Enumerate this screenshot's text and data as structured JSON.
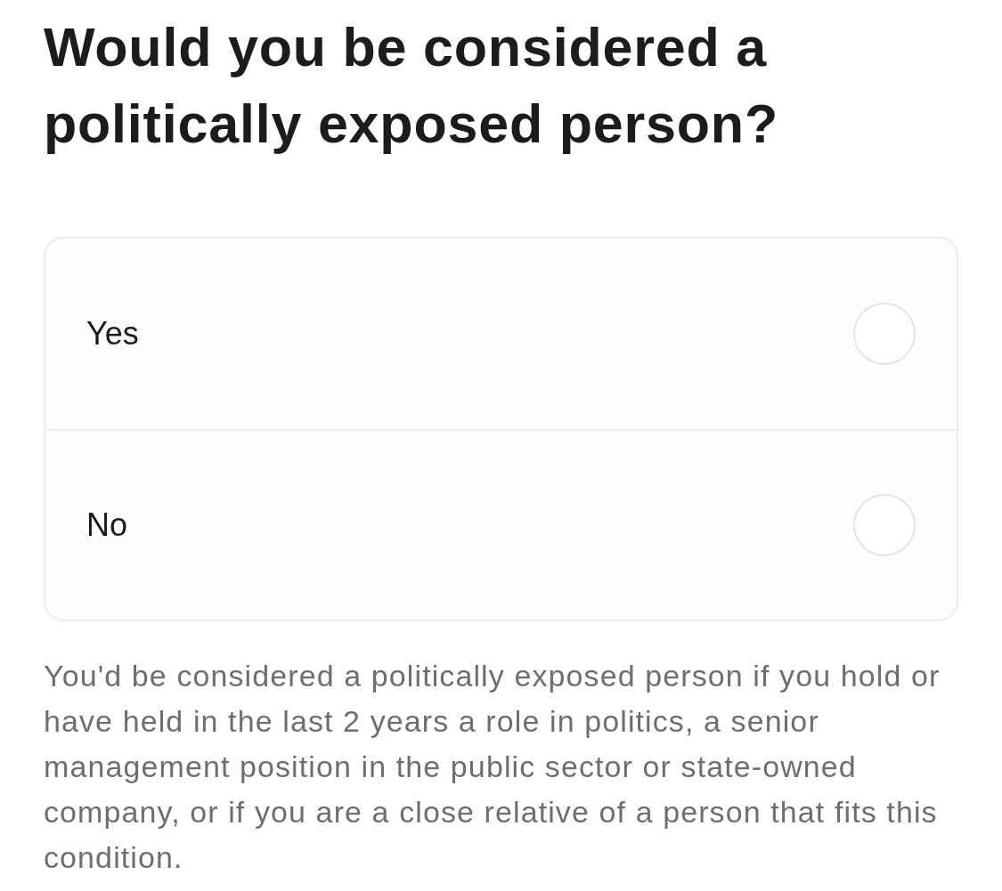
{
  "question": {
    "title": "Would you be considered a politically exposed person?"
  },
  "options": [
    {
      "label": "Yes",
      "selected": false
    },
    {
      "label": "No",
      "selected": false
    }
  ],
  "explanation": "You'd be considered a politically exposed person if you hold or have held in the last 2 years a role in politics, a senior management position in the public sector or state-owned company, or if you are a close relative of a person that fits this condition."
}
